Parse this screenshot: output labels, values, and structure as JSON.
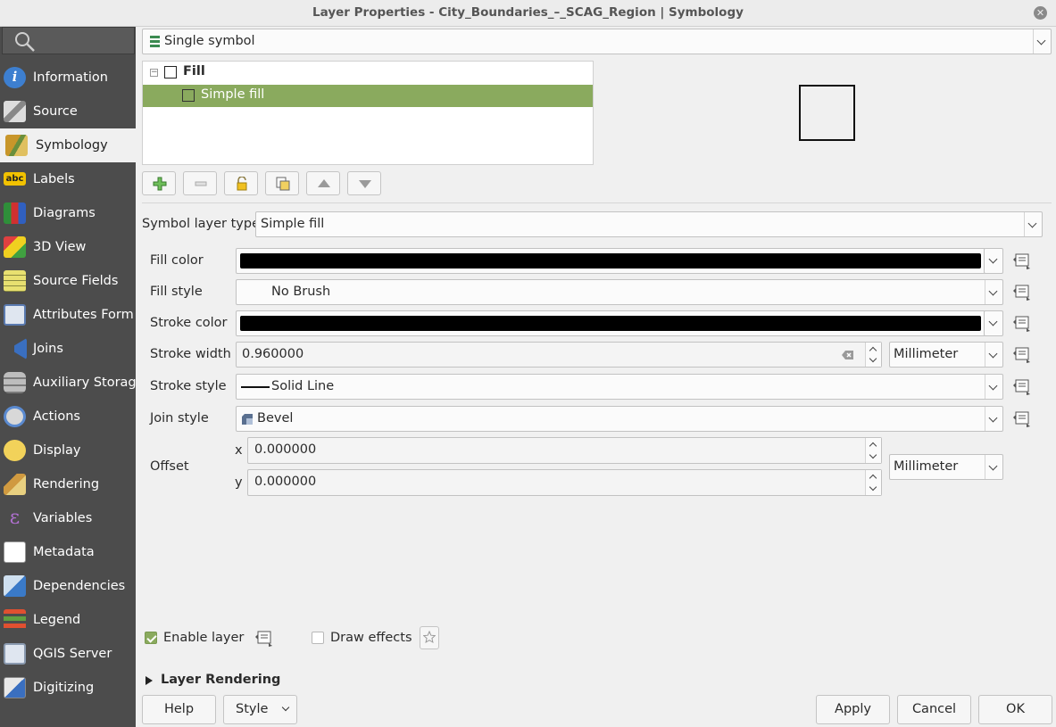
{
  "window": {
    "title": "Layer Properties - City_Boundaries_–_SCAG_Region | Symbology",
    "close_icon": "close-icon"
  },
  "sidebar": {
    "search_icon": "search-icon",
    "items": [
      {
        "label": "Information",
        "icon": "information-icon"
      },
      {
        "label": "Source",
        "icon": "source-icon"
      },
      {
        "label": "Symbology",
        "icon": "symbology-icon",
        "active": true
      },
      {
        "label": "Labels",
        "icon": "labels-icon"
      },
      {
        "label": "Diagrams",
        "icon": "diagrams-icon"
      },
      {
        "label": "3D View",
        "icon": "3d-view-icon"
      },
      {
        "label": "Source Fields",
        "icon": "source-fields-icon"
      },
      {
        "label": "Attributes Form",
        "icon": "attributes-form-icon"
      },
      {
        "label": "Joins",
        "icon": "joins-icon"
      },
      {
        "label": "Auxiliary Storage",
        "icon": "auxiliary-storage-icon"
      },
      {
        "label": "Actions",
        "icon": "actions-icon"
      },
      {
        "label": "Display",
        "icon": "display-icon"
      },
      {
        "label": "Rendering",
        "icon": "rendering-icon"
      },
      {
        "label": "Variables",
        "icon": "variables-icon"
      },
      {
        "label": "Metadata",
        "icon": "metadata-icon"
      },
      {
        "label": "Dependencies",
        "icon": "dependencies-icon"
      },
      {
        "label": "Legend",
        "icon": "legend-icon"
      },
      {
        "label": "QGIS Server",
        "icon": "qgis-server-icon"
      },
      {
        "label": "Digitizing",
        "icon": "digitizing-icon"
      }
    ]
  },
  "renderer": {
    "value": "Single symbol"
  },
  "symbol_tree": {
    "root": "Fill",
    "child": "Simple fill"
  },
  "toolbar_icons": [
    "add-layer-icon",
    "remove-layer-icon",
    "lock-icon",
    "duplicate-icon",
    "move-up-icon",
    "move-down-icon"
  ],
  "symbol_layer_type": {
    "label": "Symbol layer type",
    "value": "Simple fill"
  },
  "props": {
    "fill_color": {
      "label": "Fill color",
      "color": "#000000"
    },
    "fill_style": {
      "label": "Fill style",
      "value": "No Brush"
    },
    "stroke_color": {
      "label": "Stroke color",
      "color": "#000000"
    },
    "stroke_width": {
      "label": "Stroke width",
      "value": "0.960000",
      "unit": "Millimeter"
    },
    "stroke_style": {
      "label": "Stroke style",
      "value": "Solid Line"
    },
    "join_style": {
      "label": "Join style",
      "value": "Bevel"
    },
    "offset": {
      "label": "Offset",
      "x_label": "x",
      "x": "0.000000",
      "y_label": "y",
      "y": "0.000000",
      "unit": "Millimeter"
    }
  },
  "enable_layer": {
    "label": "Enable layer",
    "checked": true
  },
  "draw_effects": {
    "label": "Draw effects",
    "checked": false
  },
  "layer_rendering": {
    "label": "Layer Rendering"
  },
  "buttons": {
    "help": "Help",
    "style": "Style",
    "apply": "Apply",
    "cancel": "Cancel",
    "ok": "OK"
  },
  "colors": {
    "accent_green": "#8aaa5e",
    "sidebar_bg": "#4c4c4c"
  }
}
